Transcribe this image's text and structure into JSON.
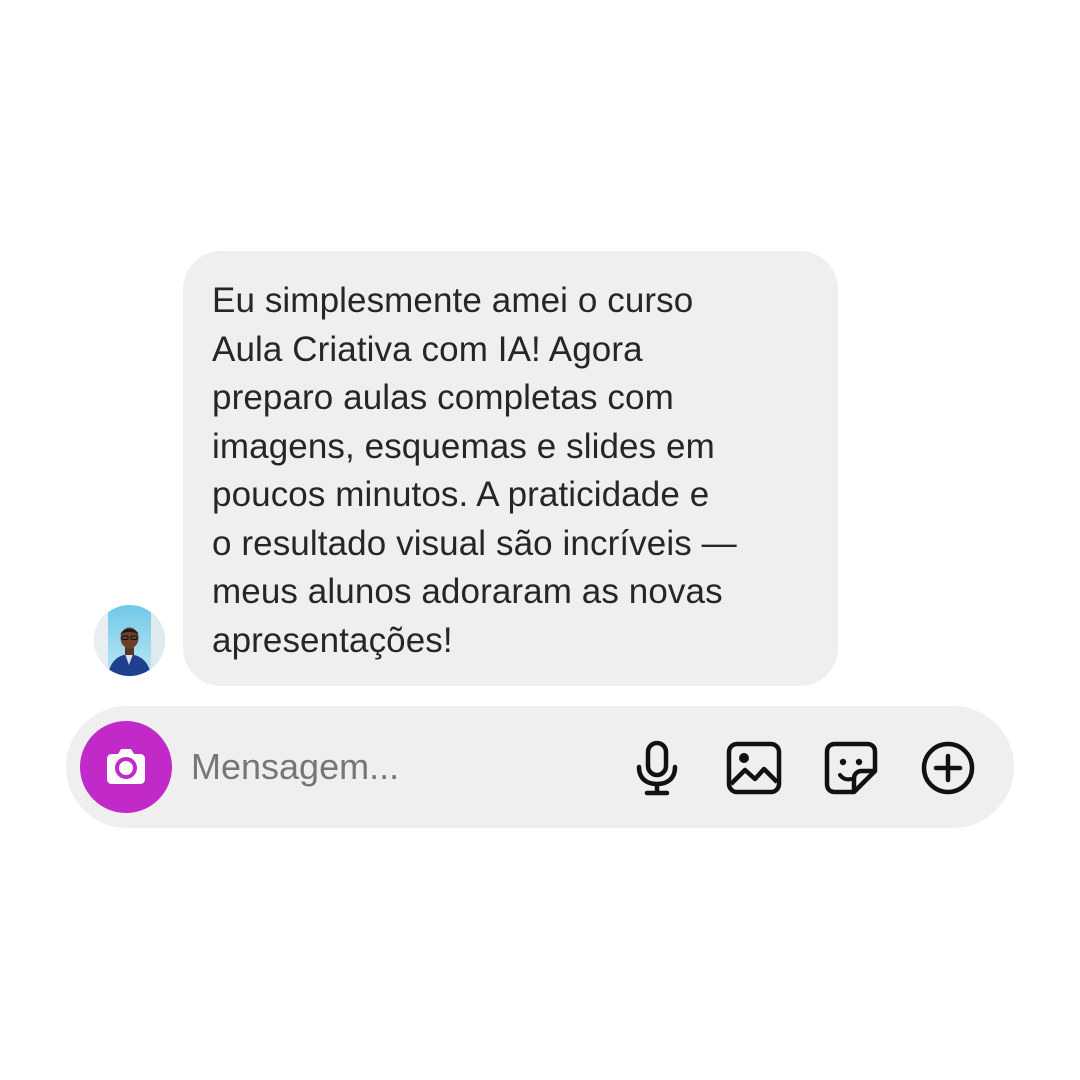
{
  "message": {
    "lines": [
      "Eu simplesmente amei o curso",
      "Aula Criativa com IA! Agora",
      "preparo aulas completas com",
      "imagens, esquemas e slides em",
      "poucos minutos. A praticidade e",
      "o resultado visual são incríveis —",
      "meus alunos adoraram as novas",
      "apresentações!"
    ]
  },
  "composer": {
    "placeholder": "Mensagem...",
    "camera_icon": "camera-icon",
    "tools": [
      "microphone-icon",
      "gallery-icon",
      "sticker-icon",
      "add-icon"
    ]
  },
  "colors": {
    "camera_button": "#c12ac9",
    "bubble_background": "#efefef",
    "composer_background": "#efefef",
    "text": "#262626",
    "placeholder": "#767676"
  }
}
